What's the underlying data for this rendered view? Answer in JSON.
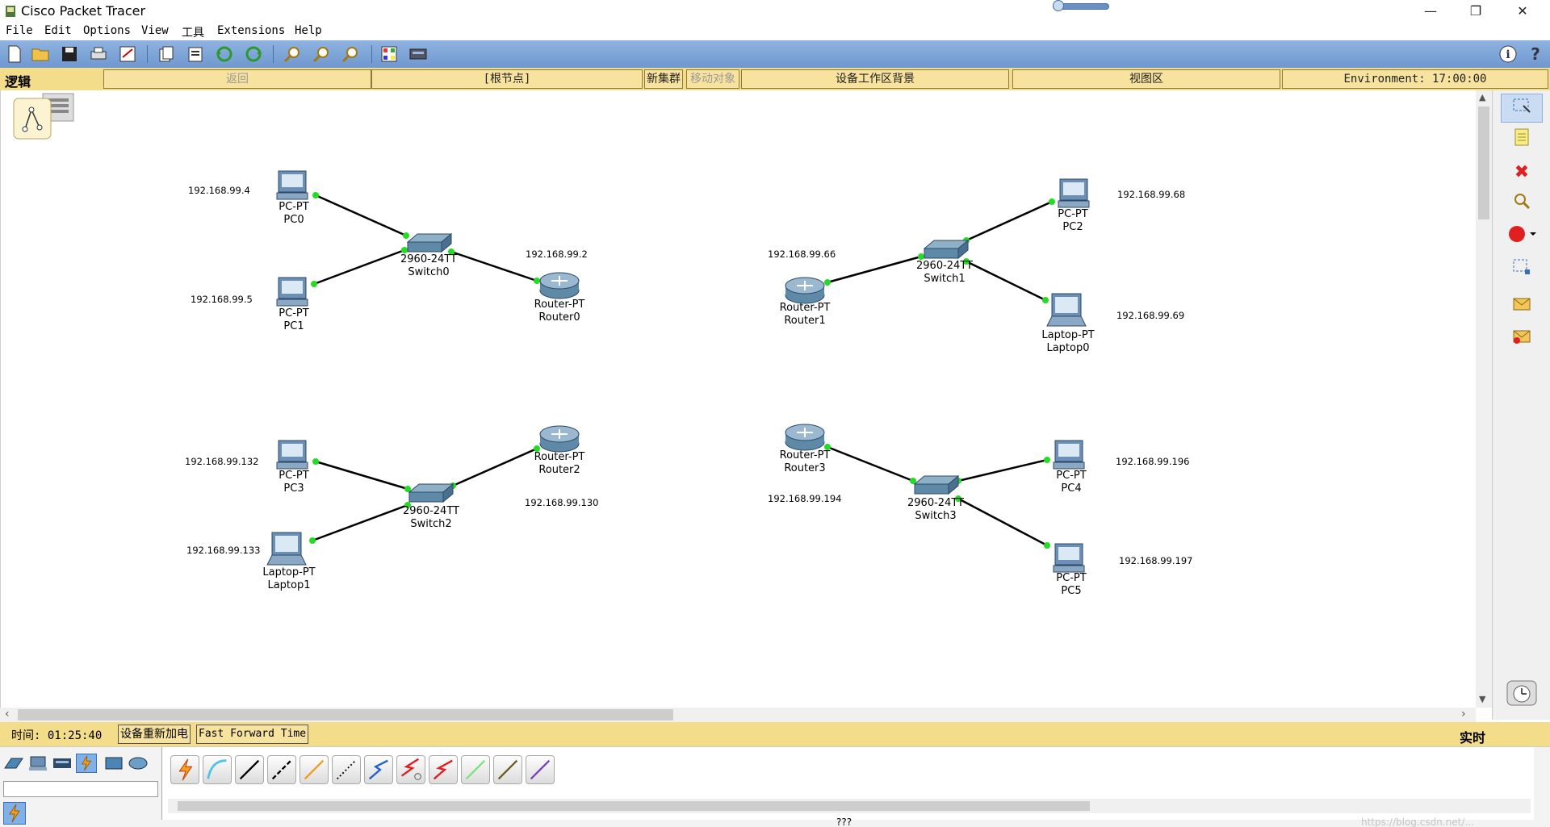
{
  "window": {
    "title": "Cisco Packet Tracer"
  },
  "menu": [
    "File",
    "Edit",
    "Options",
    "View",
    "工具",
    "Extensions",
    "Help"
  ],
  "workspace_bar": {
    "logic_label": "逻辑",
    "back_label": "返回",
    "root_label": "[根节点]",
    "new_cluster_label": "新集群",
    "move_object_label": "移动对象",
    "background_label": "设备工作区背景",
    "viewport_label": "视图区",
    "environment_label": "Environment: 17:00:00"
  },
  "devices": [
    {
      "type": "pc",
      "model": "PC-PT",
      "name": "PC0"
    },
    {
      "type": "pc",
      "model": "PC-PT",
      "name": "PC1"
    },
    {
      "type": "switch",
      "model": "2960-24TT",
      "name": "Switch0"
    },
    {
      "type": "router",
      "model": "Router-PT",
      "name": "Router0"
    },
    {
      "type": "router",
      "model": "Router-PT",
      "name": "Router1"
    },
    {
      "type": "switch",
      "model": "2960-24TT",
      "name": "Switch1"
    },
    {
      "type": "pc",
      "model": "PC-PT",
      "name": "PC2"
    },
    {
      "type": "laptop",
      "model": "Laptop-PT",
      "name": "Laptop0"
    },
    {
      "type": "pc",
      "model": "PC-PT",
      "name": "PC3"
    },
    {
      "type": "laptop",
      "model": "Laptop-PT",
      "name": "Laptop1"
    },
    {
      "type": "switch",
      "model": "2960-24TT",
      "name": "Switch2"
    },
    {
      "type": "router",
      "model": "Router-PT",
      "name": "Router2"
    },
    {
      "type": "router",
      "model": "Router-PT",
      "name": "Router3"
    },
    {
      "type": "switch",
      "model": "2960-24TT",
      "name": "Switch3"
    },
    {
      "type": "pc",
      "model": "PC-PT",
      "name": "PC4"
    },
    {
      "type": "pc",
      "model": "PC-PT",
      "name": "PC5"
    }
  ],
  "ip_labels": [
    "192.168.99.4",
    "192.168.99.5",
    "192.168.99.2",
    "192.168.99.66",
    "192.168.99.68",
    "192.168.99.69",
    "192.168.99.132",
    "192.168.99.133",
    "192.168.99.130",
    "192.168.99.194",
    "192.168.99.196",
    "192.168.99.197"
  ],
  "timebar": {
    "time_label": "时间: 01:25:40",
    "power_cycle_label": "设备重新加电",
    "fast_forward_label": "Fast Forward Time",
    "realtime_label": "实时"
  },
  "bottom": {
    "status_text": "???",
    "watermark": "https://blog.csdn.net/..."
  },
  "colors": {
    "toolbar": "#7aa2d6",
    "workspace_bar": "#f3dc8a",
    "link": "#000000",
    "port_up": "#22dd22"
  }
}
